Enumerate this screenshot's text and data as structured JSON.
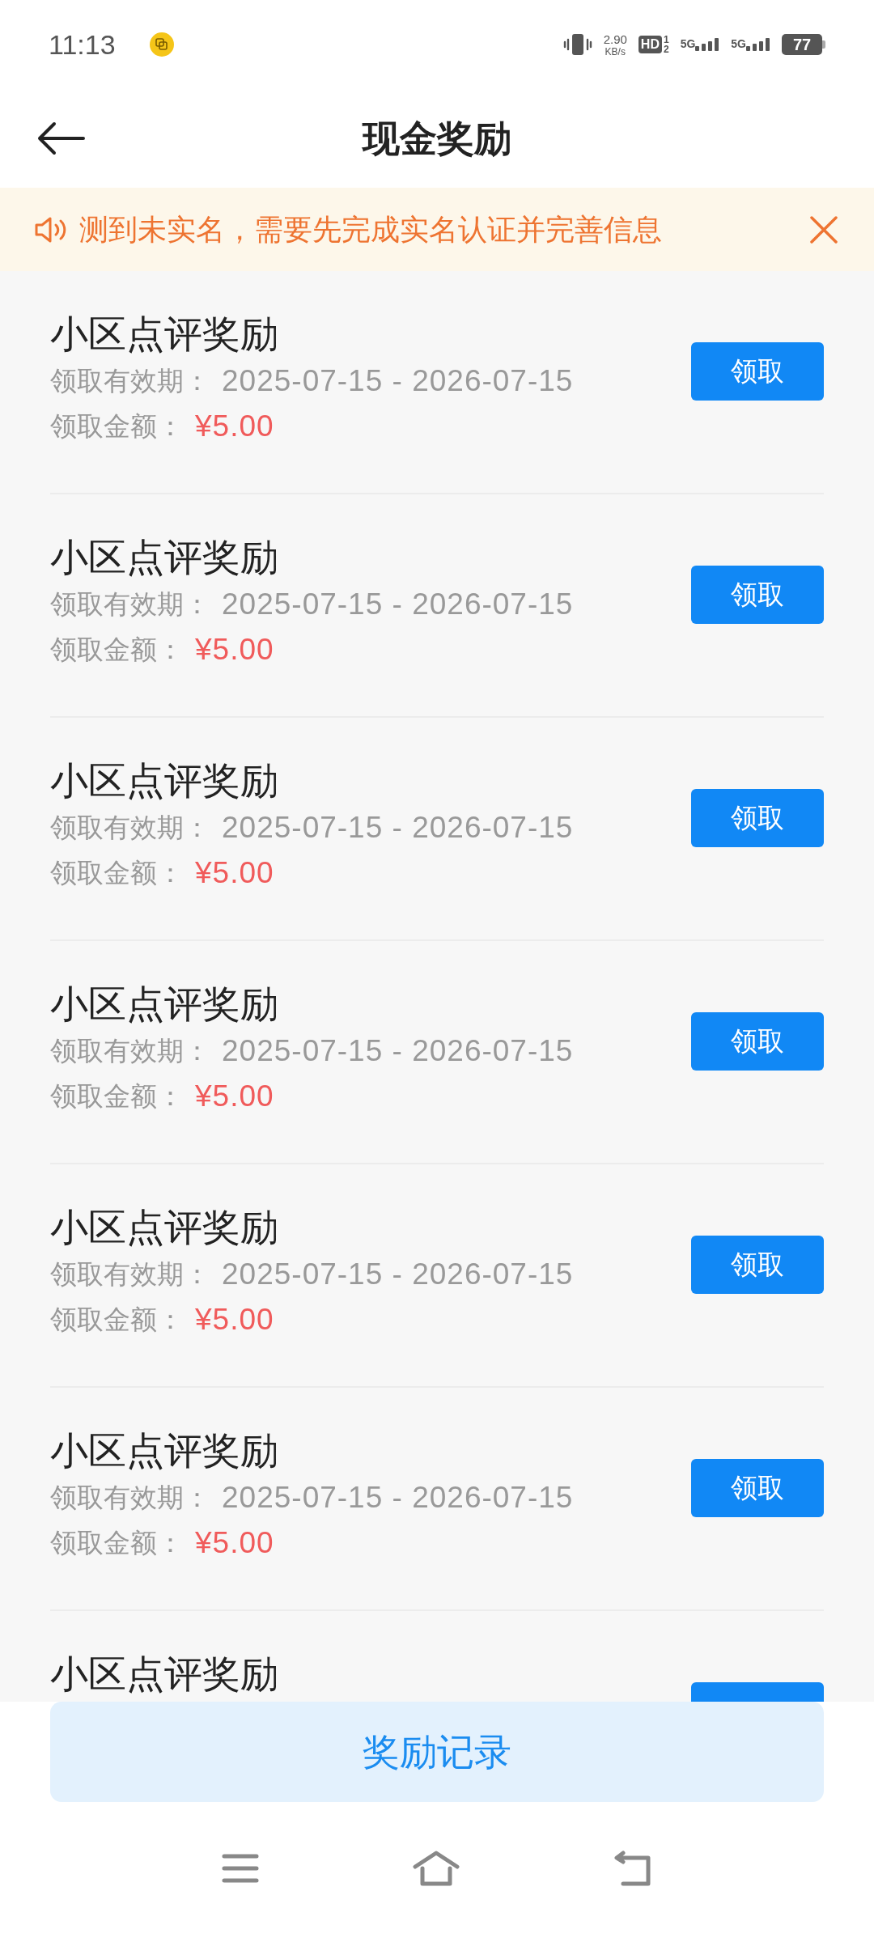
{
  "status_bar": {
    "time": "11:13",
    "speed": "2.90",
    "speed_unit": "KB/s",
    "hd": "HD",
    "hd_slots": [
      "1",
      "2"
    ],
    "networks": [
      "5G",
      "5G"
    ],
    "battery": "77"
  },
  "header": {
    "title": "现金奖励"
  },
  "notice": {
    "text": "测到未实名，需要先完成实名认证并完善信息"
  },
  "rewards": [
    {
      "title": "小区点评奖励",
      "validity_label": "领取有效期：",
      "validity": "2025-07-15 - 2026-07-15",
      "amount_label": "领取金额：",
      "amount": "¥5.00",
      "button": "领取"
    },
    {
      "title": "小区点评奖励",
      "validity_label": "领取有效期：",
      "validity": "2025-07-15 - 2026-07-15",
      "amount_label": "领取金额：",
      "amount": "¥5.00",
      "button": "领取"
    },
    {
      "title": "小区点评奖励",
      "validity_label": "领取有效期：",
      "validity": "2025-07-15 - 2026-07-15",
      "amount_label": "领取金额：",
      "amount": "¥5.00",
      "button": "领取"
    },
    {
      "title": "小区点评奖励",
      "validity_label": "领取有效期：",
      "validity": "2025-07-15 - 2026-07-15",
      "amount_label": "领取金额：",
      "amount": "¥5.00",
      "button": "领取"
    },
    {
      "title": "小区点评奖励",
      "validity_label": "领取有效期：",
      "validity": "2025-07-15 - 2026-07-15",
      "amount_label": "领取金额：",
      "amount": "¥5.00",
      "button": "领取"
    },
    {
      "title": "小区点评奖励",
      "validity_label": "领取有效期：",
      "validity": "2025-07-15 - 2026-07-15",
      "amount_label": "领取金额：",
      "amount": "¥5.00",
      "button": "领取"
    },
    {
      "title": "小区点评奖励"
    }
  ],
  "footer_button": "奖励记录"
}
